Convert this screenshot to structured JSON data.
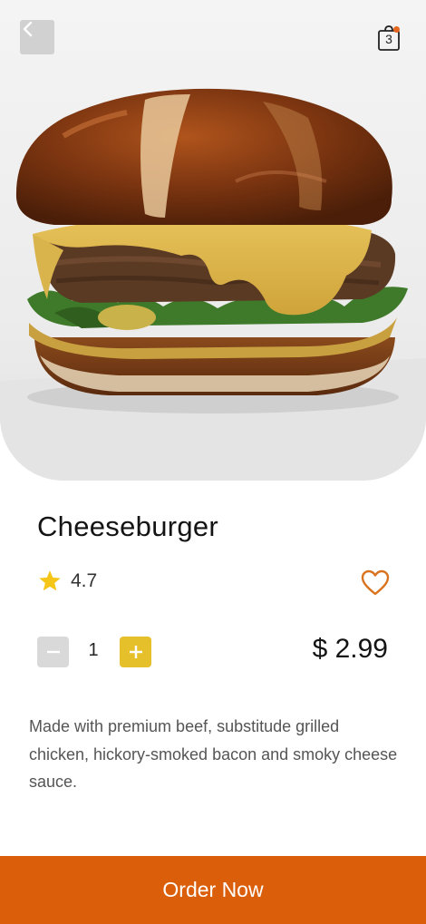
{
  "header": {
    "back_icon": "chevron-left-icon",
    "cart_icon": "shopping-bag-icon",
    "cart_count": "3",
    "cart_dot_color": "#e5661d"
  },
  "product": {
    "image": "cheeseburger-photo",
    "name": "Cheeseburger",
    "rating": "4.7",
    "star_color": "#f5c518",
    "favorite_icon": "heart-icon",
    "favorite_color": "#d9731e",
    "quantity": "1",
    "price": "$ 2.99",
    "description": "Made with premium beef, substitude grilled chicken, hickory-smoked bacon and smoky cheese sauce."
  },
  "actions": {
    "order_label": "Order Now",
    "order_color": "#db5f0b",
    "plus_color": "#e6c02a",
    "minus_color": "#d9d9d9"
  }
}
